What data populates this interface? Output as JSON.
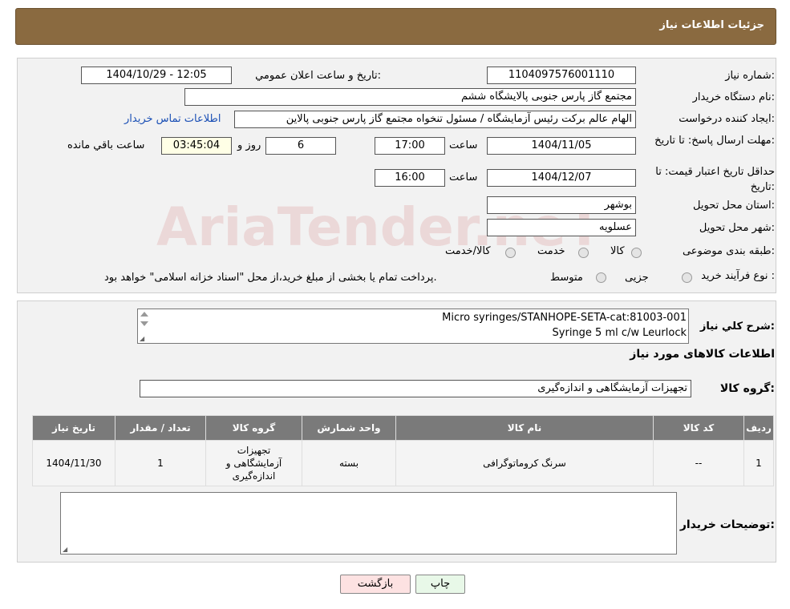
{
  "header": {
    "title": "جزئیات اطلاعات نیاز"
  },
  "form": {
    "need_number_label": "شماره نیاز:",
    "need_number": "1104097576001110",
    "announce_label": "تاریخ و ساعت اعلان عمومي:",
    "announce_value": "1404/10/29 - 12:05",
    "buyer_org_label": "نام دستگاه خریدار:",
    "buyer_org": "مجتمع گاز پارس جنوبی  پالایشگاه ششم",
    "requester_label": "ایجاد کننده درخواست:",
    "requester": "الهام عالم برکت رئیس آزمایشگاه / مسئول تنخواه مجتمع گاز پارس جنوبی  پالاین",
    "contact_link": "اطلاعات تماس خریدار",
    "deadline_label": "مهلت ارسال پاسخ: تا تاریخ:",
    "deadline_date": "1404/11/05",
    "time_label": "ساعت",
    "deadline_time": "17:00",
    "days_value": "6",
    "days_label": "روز و",
    "remaining_time": "03:45:04",
    "remaining_label": "ساعت باقي مانده",
    "validity_label": "حداقل تاریخ اعتبار قیمت: تا تاریخ:",
    "validity_date": "1404/12/07",
    "validity_time": "16:00",
    "province_label": "استان محل تحویل:",
    "province": "بوشهر",
    "city_label": "شهر محل تحویل:",
    "city": "عسلویه",
    "category_label": "طبقه بندی موضوعی:",
    "category_options": [
      "کالا",
      "خدمت",
      "کالا/خدمت"
    ],
    "process_label": "نوع فرآیند خرید :",
    "process_options": [
      "جزیی",
      "متوسط"
    ],
    "process_note": "پرداخت تمام یا بخشی از مبلغ خرید،از محل \"اسناد خزانه اسلامی\" خواهد بود."
  },
  "details": {
    "summary_label": "شرح كلي نياز:",
    "summary_lines": [
      "Micro syringes/STANHOPE-SETA-cat:81003-001",
      "Syringe 5 ml c/w Leurlock"
    ],
    "goods_info_title": "اطلاعات کالاهای مورد نیاز",
    "goods_group_label": "گروه کالا:",
    "goods_group": "تجهیزات آزمایشگاهی و اندازه‌گیری"
  },
  "table": {
    "headers": [
      "ردیف",
      "کد کالا",
      "نام کالا",
      "واحد شمارش",
      "گروه کالا",
      "تعداد / مقدار",
      "تاریخ نیاز"
    ],
    "rows": [
      [
        "1",
        "--",
        "سرنگ کروماتوگرافی",
        "بسته",
        "تجهیزات آزمایشگاهی و اندازه‌گیری",
        "1",
        "1404/11/30"
      ]
    ]
  },
  "buyer_notes": {
    "label": "توضیحات خریدار:",
    "value": ""
  },
  "buttons": {
    "print": "چاپ",
    "back": "بازگشت"
  },
  "watermark": {
    "text": "AriaTender.neT"
  }
}
